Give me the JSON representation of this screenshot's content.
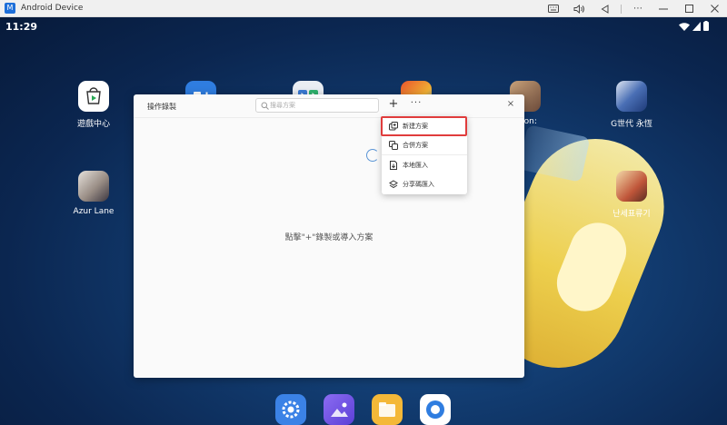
{
  "window": {
    "app_icon_glyph": "M",
    "title": "Android Device"
  },
  "status_bar": {
    "time": "11:29"
  },
  "home_apps": [
    {
      "label": "遊戲中心",
      "icon": "play-store-icon"
    },
    {
      "label": "",
      "icon": "app-icon-blue"
    },
    {
      "label": "",
      "icon": "app-icon-media"
    },
    {
      "label": "",
      "icon": "game-icon"
    },
    {
      "label": "otion:",
      "icon": "game-icon-character"
    },
    {
      "label": "G世代 永恆",
      "icon": "gundam-icon"
    },
    {
      "label": "Azur Lane",
      "icon": "azur-lane-icon"
    },
    {
      "label": "난세표류기",
      "icon": "game-icon-character2"
    }
  ],
  "dialog": {
    "title": "操作錄製",
    "search_placeholder": "搜尋方案",
    "add_label": "+",
    "more_label": "···",
    "close_label": "×",
    "empty_text": "點擊\"+\"錄製或導入方案"
  },
  "menu": {
    "items": [
      {
        "label": "新建方案",
        "icon": "new-plan-icon"
      },
      {
        "label": "合併方案",
        "icon": "merge-plan-icon"
      },
      {
        "label": "本地匯入",
        "icon": "local-import-icon"
      },
      {
        "label": "分享碼匯入",
        "icon": "share-code-import-icon"
      }
    ],
    "highlight_color": "#e03c3c"
  },
  "dock": [
    {
      "icon": "settings-icon"
    },
    {
      "icon": "gallery-icon"
    },
    {
      "icon": "files-icon"
    },
    {
      "icon": "browser-icon"
    }
  ],
  "colors": {
    "wallpaper": "#123d72",
    "dialog_bg": "#fafafa",
    "accent": "#1e6fd9"
  }
}
